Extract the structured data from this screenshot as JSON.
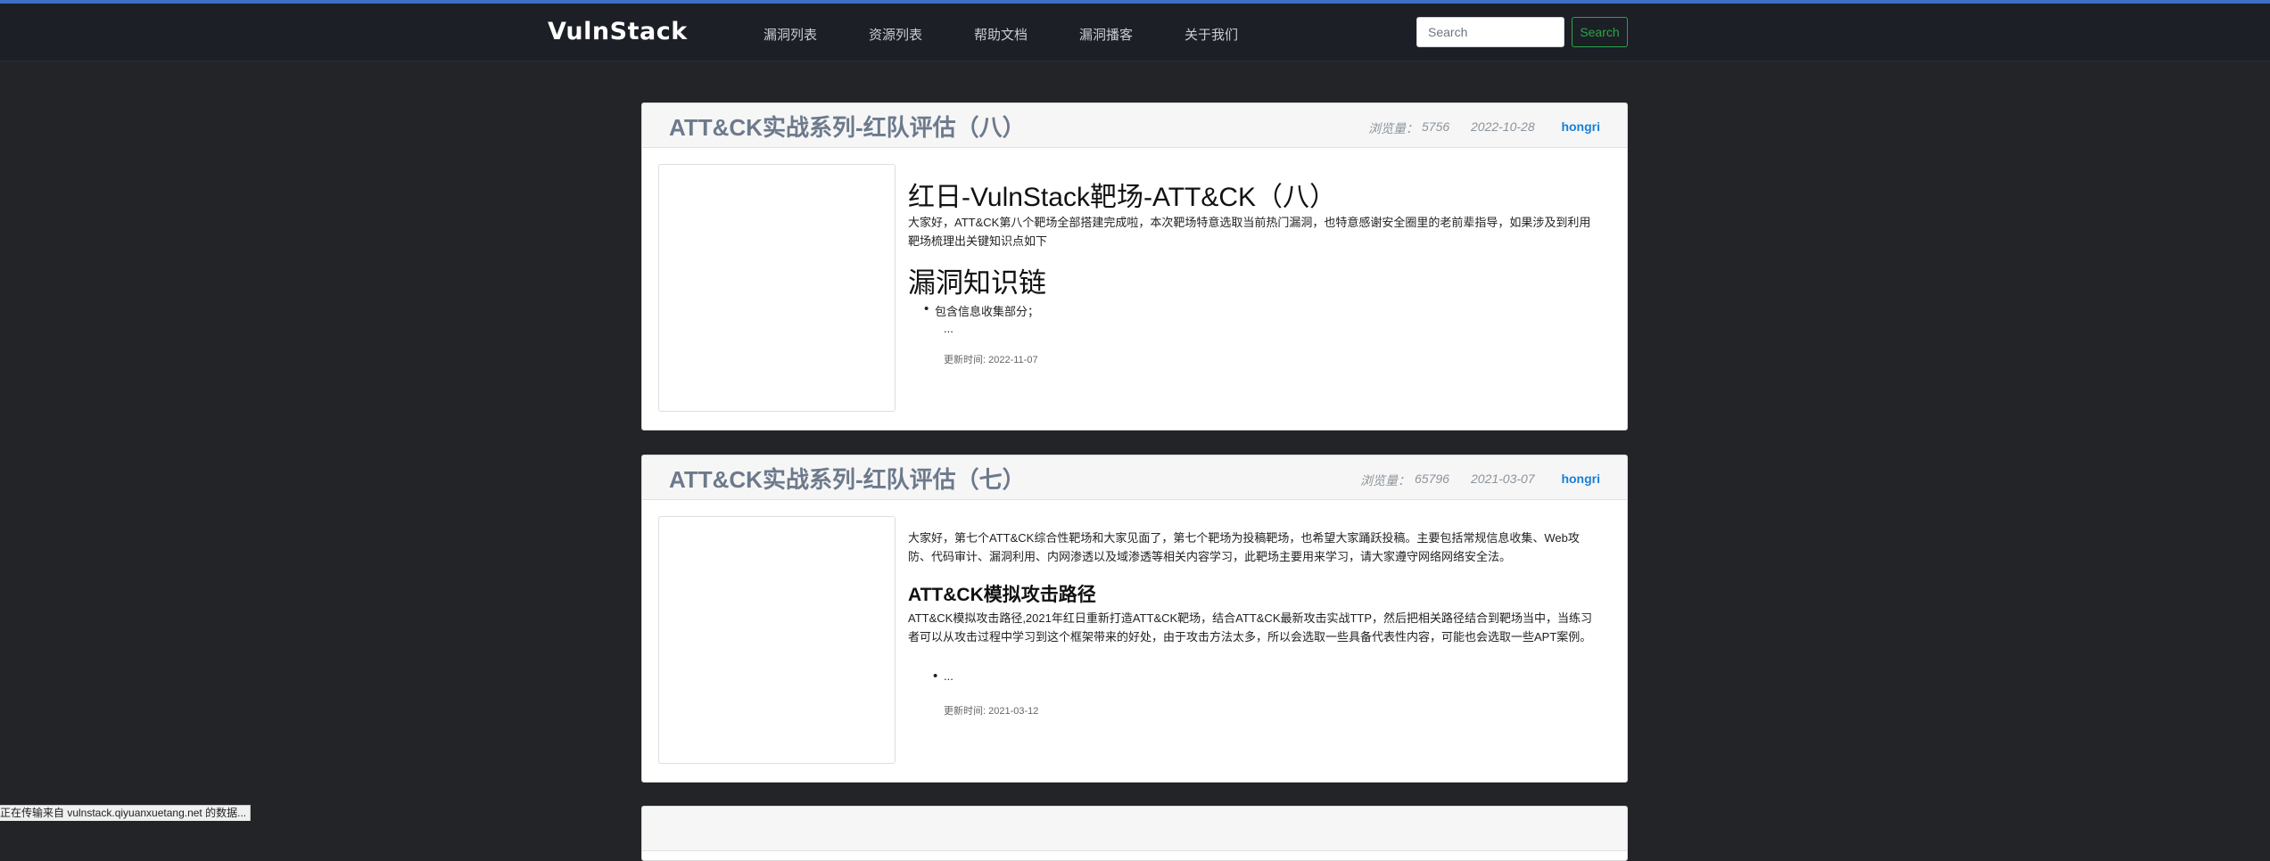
{
  "nav": {
    "brand": "VulnStack",
    "items": [
      "漏洞列表",
      "资源列表",
      "帮助文档",
      "漏洞播客",
      "关于我们"
    ],
    "search_placeholder": "Search",
    "search_button": "Search"
  },
  "articles": [
    {
      "title": "ATT&CK实战系列-红队评估（八）",
      "views_label": "浏览量：",
      "views": "5756",
      "date": "2022-10-28",
      "author": "hongri",
      "heading": "红日-VulnStack靶场-ATT&CK（八）",
      "paragraph": "大家好，ATT&CK第八个靶场全部搭建完成啦，本次靶场特意选取当前热门漏洞，也特意感谢安全圈里的老前辈指导，如果涉及到利用靶场梳理出关键知识点如下",
      "subheading": "漏洞知识链",
      "bullet": "包含信息收集部分；",
      "ellipsis": "...",
      "updated": "更新时间: 2022-11-07"
    },
    {
      "title": "ATT&CK实战系列-红队评估（七）",
      "views_label": "浏览量：",
      "views": "65796",
      "date": "2021-03-07",
      "author": "hongri",
      "paragraph": "大家好，第七个ATT&CK综合性靶场和大家见面了，第七个靶场为投稿靶场，也希望大家踊跃投稿。主要包括常规信息收集、Web攻防、代码审计、漏洞利用、内网渗透以及域渗透等相关内容学习，此靶场主要用来学习，请大家遵守网络网络安全法。",
      "subheading": "ATT&CK模拟攻击路径",
      "paragraph2": "ATT&CK模拟攻击路径,2021年红日重新打造ATT&CK靶场，结合ATT&CK最新攻击实战TTP，然后把相关路径结合到靶场当中，当练习者可以从攻击过程中学习到这个框架带来的好处，由于攻击方法太多，所以会选取一些具备代表性内容，可能也会选取一些APT案例。",
      "bullet": "...",
      "updated": "更新时间: 2021-03-12"
    }
  ],
  "status_bar": "正在传输来自 vulnstack.qiyuanxuetang.net 的数据..."
}
